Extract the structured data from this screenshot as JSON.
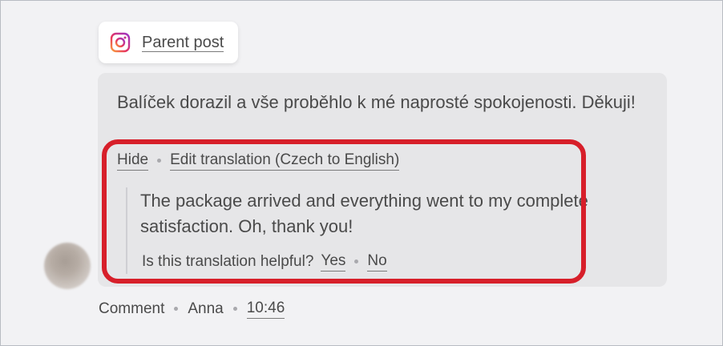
{
  "parent_post": {
    "label": "Parent post",
    "icon": "instagram-icon"
  },
  "comment": {
    "original_text": "Balíček dorazil a vše proběhlo k mé naprosté spokojenosti. Děkuji!",
    "actions": {
      "hide_label": "Hide",
      "edit_translation_label": "Edit translation (Czech to English)"
    },
    "translation": {
      "text": "The package arrived and everything went to my complete satisfaction. Oh, thank you!",
      "helpful_question": "Is this translation helpful?",
      "yes_label": "Yes",
      "no_label": "No"
    }
  },
  "meta": {
    "comment_label": "Comment",
    "author": "Anna",
    "time": "10:46"
  },
  "colors": {
    "highlight_border": "#d71f2a",
    "bubble_background": "#e6e6e8",
    "page_background": "#f2f2f4"
  }
}
